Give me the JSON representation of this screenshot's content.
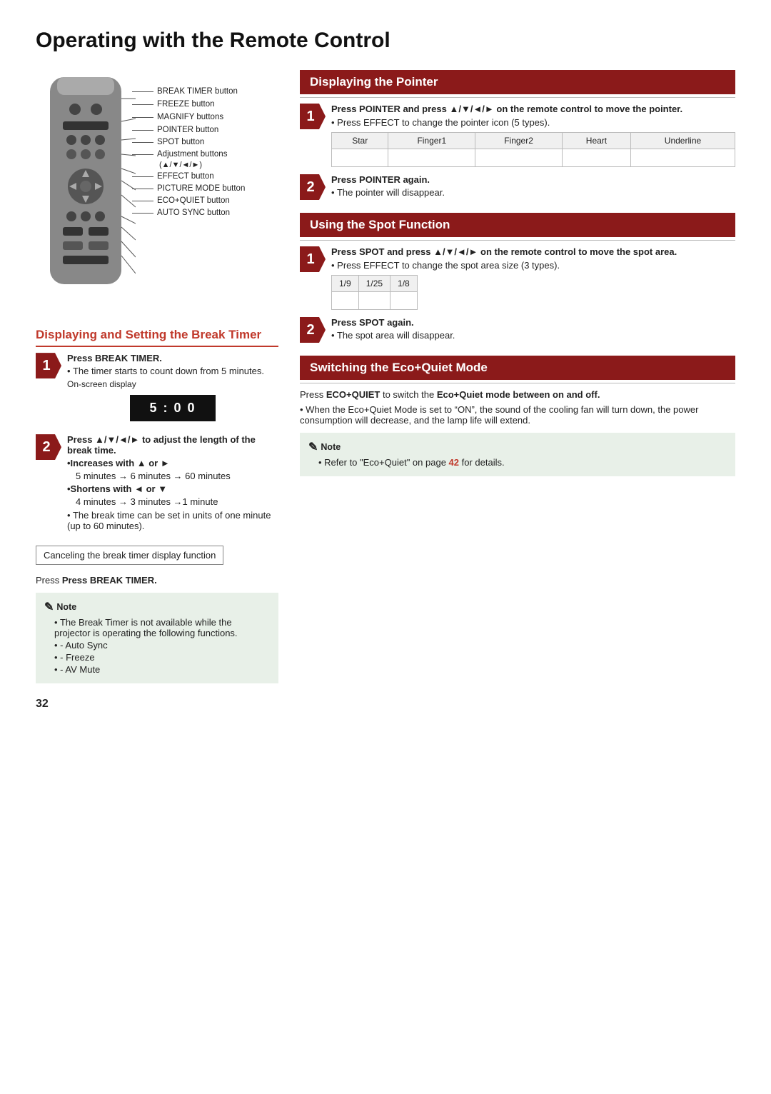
{
  "page": {
    "title": "Operating with the Remote Control",
    "page_number": "32"
  },
  "remote": {
    "labels": [
      "BREAK TIMER button",
      "FREEZE button",
      "MAGNIFY buttons",
      "POINTER button",
      "SPOT button",
      "Adjustment buttons",
      "(▲/▼/◄/►)",
      "EFFECT button",
      "PICTURE MODE button",
      "ECO+QUIET button",
      "AUTO SYNC button"
    ]
  },
  "break_timer": {
    "section_title": "Displaying and Setting the Break Timer",
    "step1_label": "Press BREAK TIMER.",
    "step1_desc": "The timer starts to count down from 5 minutes.",
    "step1_sub": "On-screen display",
    "timer_display": "5 : 0 0",
    "step2_label": "Press ▲/▼/◄/► to adjust the length of the break time.",
    "step2_bullet1": "•Increases with ▲ or ►",
    "step2_detail1": "5 minutes → 6 minutes → 60 minutes",
    "step2_bullet2": "•Shortens with ◄ or ▼",
    "step2_detail2": "4 minutes → 3 minutes →1 minute",
    "step2_note": "The break time can be set in units of one minute (up to 60 minutes).",
    "cancel_box": "Canceling the break timer display function",
    "press_break_label": "Press BREAK TIMER.",
    "note_title": "Note",
    "note_items": [
      "The Break Timer is not available while the projector is operating the following functions.",
      "- Auto Sync",
      "- Freeze",
      "- AV Mute"
    ]
  },
  "displaying_pointer": {
    "section_title": "Displaying the Pointer",
    "step1_label": "Press POINTER and press ▲/▼/◄/► on the remote control to move the pointer.",
    "step1_bullet": "Press EFFECT to change the pointer icon (5 types).",
    "table_headers": [
      "Star",
      "Finger1",
      "Finger2",
      "Heart",
      "Underline"
    ],
    "step2_label": "Press POINTER again.",
    "step2_bullet": "The pointer will disappear."
  },
  "spot_function": {
    "section_title": "Using the Spot Function",
    "step1_label": "Press SPOT and press ▲/▼/◄/► on the remote control to move the spot area.",
    "step1_bullet": "Press EFFECT to change the spot area size (3 types).",
    "table_headers": [
      "1/9",
      "1/25",
      "1/8"
    ],
    "step2_label": "Press SPOT again.",
    "step2_bullet": "The spot area will disappear."
  },
  "eco_quiet": {
    "section_title": "Switching the Eco+Quiet Mode",
    "step_label": "Press ECO+QUIET to switch the Eco+Quiet mode between on and off.",
    "bullet": "When the Eco+Quiet Mode is set to “ON”, the sound of the cooling fan will turn down, the power consumption will decrease, and the lamp life will extend.",
    "note_title": "Note",
    "note_items": [
      "Refer to “Eco+Quiet” on page 42 for details."
    ],
    "page_ref": "42"
  }
}
